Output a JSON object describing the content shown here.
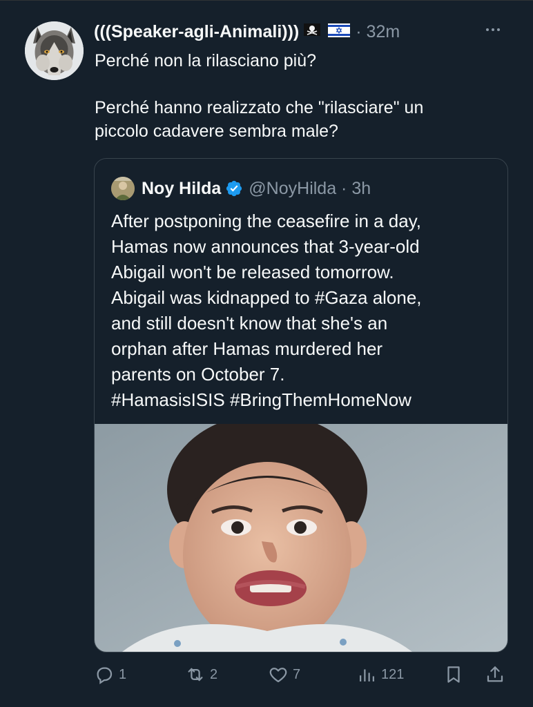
{
  "tweet": {
    "author": {
      "display_name": "(((Speaker-agli-Animali)))",
      "name_emojis": [
        "pirate-flag-icon",
        "israel-flag-icon"
      ],
      "timestamp": "· 32m",
      "avatar": "wolf-avatar"
    },
    "text_lines": [
      "Perché non la rilasciano più?",
      "",
      "Perché hanno realizzato che \"rilasciare\" un",
      "piccolo cadavere sembra male?"
    ],
    "more_icon": "more-icon"
  },
  "quoted_tweet": {
    "author": {
      "display_name": "Noy Hilda",
      "verified": true,
      "handle_time": "@NoyHilda · 3h"
    },
    "text_lines": [
      "After postponing the ceasefire in a day,",
      "Hamas now announces that 3-year-old",
      "Abigail won't be released tomorrow.",
      "Abigail was kidnapped to #Gaza alone,",
      "and still doesn't know that she's an",
      "orphan after Hamas murdered her",
      "parents on October 7.",
      "#HamasisISIS #BringThemHomeNow"
    ],
    "image": "photo of a smiling toddler with dark hair against a grey wall"
  },
  "actions": {
    "reply": {
      "icon": "reply-icon",
      "count": "1"
    },
    "retweet": {
      "icon": "retweet-icon",
      "count": "2"
    },
    "like": {
      "icon": "like-icon",
      "count": "7"
    },
    "views": {
      "icon": "views-icon",
      "count": "121"
    },
    "bookmark": {
      "icon": "bookmark-icon"
    },
    "share": {
      "icon": "share-icon"
    }
  },
  "colors": {
    "background": "#15202b",
    "text_primary": "#f7f9f9",
    "text_secondary": "#8b98a5",
    "border": "#38444d",
    "verified": "#1d9bf0"
  }
}
